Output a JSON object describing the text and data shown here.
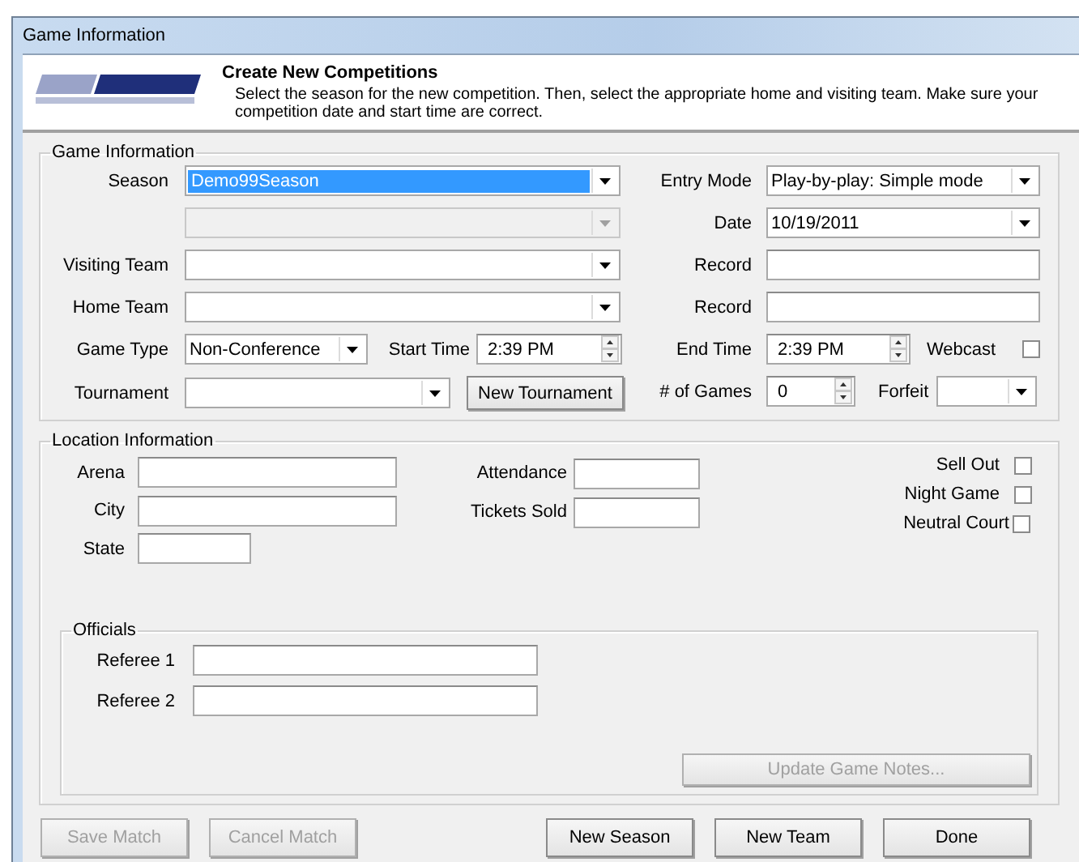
{
  "window": {
    "title": "Game Information"
  },
  "header": {
    "title": "Create New Competitions",
    "description": "Select the season for the new competition.  Then, select the appropriate home and visiting team. Make sure your competition date and start time are correct."
  },
  "game_information": {
    "title": "Game Information",
    "season": {
      "label": "Season",
      "value": "Demo99Season",
      "selected": true
    },
    "season_2": {
      "disabled": true
    },
    "visiting_team": {
      "label": "Visiting Team"
    },
    "home_team": {
      "label": "Home Team"
    },
    "game_type": {
      "label": "Game Type",
      "value": "Non-Conference"
    },
    "start_time": {
      "label": "Start Time",
      "value": "2:39 PM"
    },
    "tournament": {
      "label": "Tournament"
    },
    "new_tournament_button": {
      "label": "New Tournament"
    },
    "entry_mode": {
      "label": "Entry Mode",
      "value": "Play-by-play: Simple mode"
    },
    "date": {
      "label": "Date",
      "value": "10/19/2011"
    },
    "visiting_record": {
      "label": "Record"
    },
    "home_record": {
      "label": "Record"
    },
    "end_time": {
      "label": "End Time",
      "value": "2:39 PM"
    },
    "webcast": {
      "label": "Webcast",
      "checked": false
    },
    "number_of_games": {
      "label": "# of Games",
      "value": "0"
    },
    "forfeit": {
      "label": "Forfeit"
    }
  },
  "location_information": {
    "title": "Location Information",
    "arena": {
      "label": "Arena"
    },
    "city": {
      "label": "City"
    },
    "state": {
      "label": "State"
    },
    "attendance": {
      "label": "Attendance"
    },
    "tickets_sold": {
      "label": "Tickets Sold"
    },
    "sell_out": {
      "label": "Sell Out",
      "checked": false
    },
    "night_game": {
      "label": "Night Game",
      "checked": false
    },
    "neutral_court": {
      "label": "Neutral Court",
      "checked": false
    },
    "officials": {
      "title": "Officials",
      "referee_1": {
        "label": "Referee 1"
      },
      "referee_2": {
        "label": "Referee 2"
      }
    },
    "update_game_notes_button": {
      "label": "Update Game Notes...",
      "disabled": true
    }
  },
  "buttons": [
    {
      "label": "Save Match",
      "disabled": true
    },
    {
      "label": "Cancel Match",
      "disabled": true
    },
    {
      "label": "New Season",
      "disabled": false
    },
    {
      "label": "New Team",
      "disabled": false
    },
    {
      "label": "Done",
      "disabled": false
    }
  ]
}
